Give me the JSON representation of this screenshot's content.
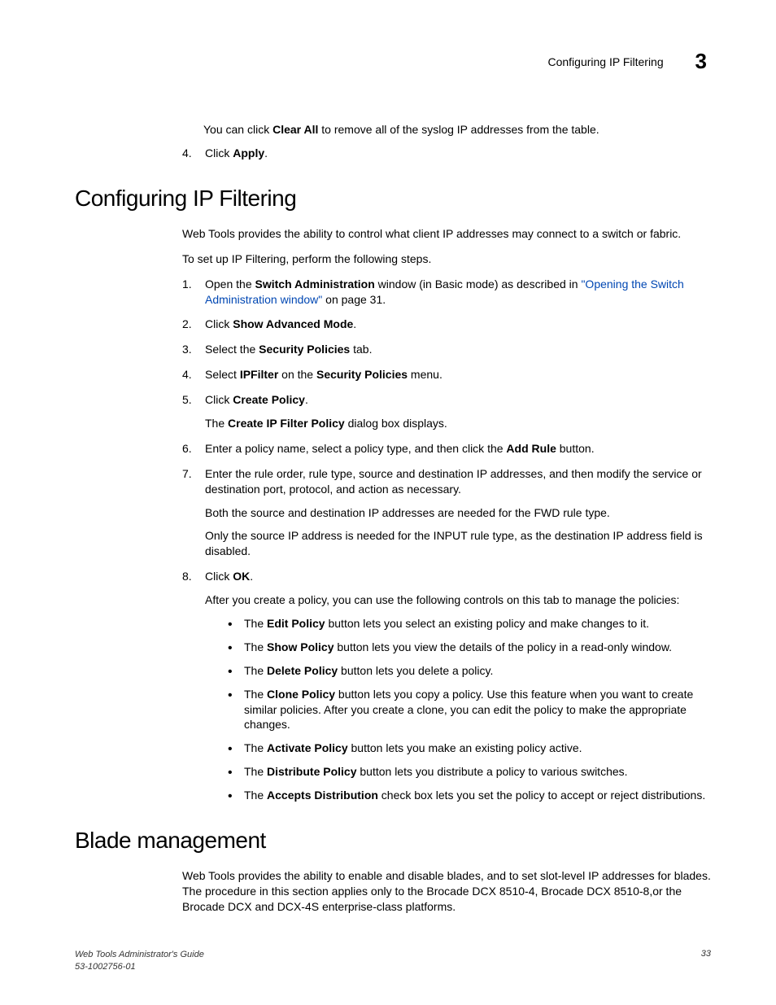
{
  "header": {
    "title": "Configuring IP Filtering",
    "chapter": "3"
  },
  "top": {
    "clear_all_sentence_pre": "You can click ",
    "clear_all_bold": "Clear All",
    "clear_all_sentence_post": " to remove all of the syslog IP addresses from the table.",
    "step4_num": "4.",
    "step4_pre": "Click ",
    "step4_bold": "Apply",
    "step4_post": "."
  },
  "section1": {
    "heading": "Configuring IP Filtering",
    "intro1": "Web Tools provides the ability to control what client IP addresses may connect to a switch or fabric.",
    "intro2": "To set up IP Filtering, perform the following steps.",
    "steps": {
      "s1": {
        "num": "1.",
        "pre": "Open the ",
        "b1": "Switch Administration",
        "mid": " window (in Basic mode) as described in ",
        "link": "\"Opening the Switch Administration window\"",
        "post": " on page 31."
      },
      "s2": {
        "num": "2.",
        "pre": "Click ",
        "b1": "Show Advanced Mode",
        "post": "."
      },
      "s3": {
        "num": "3.",
        "pre": "Select the ",
        "b1": "Security Policies",
        "post": " tab."
      },
      "s4": {
        "num": "4.",
        "pre": "Select ",
        "b1": "IPFilter",
        "mid": " on the ",
        "b2": "Security Policies",
        "post": " menu."
      },
      "s5": {
        "num": "5.",
        "pre": "Click ",
        "b1": "Create Policy",
        "post": ".",
        "sub_pre": "The ",
        "sub_b": "Create IP Filter Policy",
        "sub_post": " dialog box displays."
      },
      "s6": {
        "num": "6.",
        "pre": "Enter a policy name, select a policy type, and then click the ",
        "b1": "Add Rule",
        "post": " button."
      },
      "s7": {
        "num": "7.",
        "text": "Enter the rule order, rule type, source and destination IP addresses, and then modify the service or destination port, protocol, and action as necessary.",
        "sub1": "Both the source and destination IP addresses are needed for the FWD rule type.",
        "sub2": "Only the source IP address is needed for the INPUT rule type, as the destination IP address field is disabled."
      },
      "s8": {
        "num": "8.",
        "pre": "Click ",
        "b1": "OK",
        "post": ".",
        "sub": "After you create a policy, you can use the following controls on this tab to manage the policies:"
      }
    },
    "bullets": {
      "b1": {
        "pre": "The ",
        "bold": "Edit Policy",
        "post": " button lets you select an existing policy and make changes to it."
      },
      "b2": {
        "pre": "The ",
        "bold": "Show Policy",
        "post": " button lets you view the details of the policy in a read-only window."
      },
      "b3": {
        "pre": "The ",
        "bold": "Delete Policy",
        "post": " button lets you delete a policy."
      },
      "b4": {
        "pre": "The ",
        "bold": "Clone Policy",
        "post": " button lets you copy a policy. Use this feature when you want to create similar policies. After you create a clone, you can edit the policy to make the appropriate changes."
      },
      "b5": {
        "pre": "The ",
        "bold": "Activate Policy",
        "post": " button lets you make an existing policy active."
      },
      "b6": {
        "pre": "The ",
        "bold": "Distribute Policy",
        "post": " button lets you distribute a policy to various switches."
      },
      "b7": {
        "pre": "The ",
        "bold": "Accepts Distribution",
        "post": " check box lets you set the policy to accept or reject distributions."
      }
    }
  },
  "section2": {
    "heading": "Blade management",
    "para": "Web Tools provides the ability to enable and disable blades, and to set slot-level IP addresses for blades. The procedure in this section applies only to the Brocade DCX 8510-4, Brocade DCX 8510-8,or the Brocade DCX and DCX-4S enterprise-class platforms."
  },
  "footer": {
    "guide": "Web Tools Administrator's Guide",
    "docnum": "53-1002756-01",
    "page": "33"
  }
}
